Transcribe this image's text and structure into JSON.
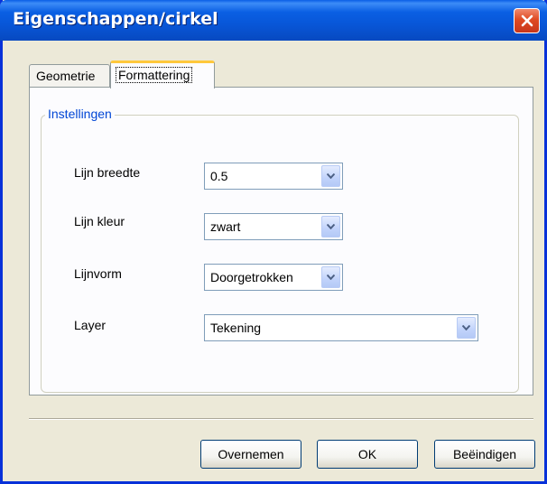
{
  "window": {
    "title": "Eigenschappen/cirkel"
  },
  "tabs": [
    {
      "label": "Geometrie",
      "selected": false
    },
    {
      "label": "Formattering",
      "selected": true
    }
  ],
  "group": {
    "legend": "Instellingen"
  },
  "fields": [
    {
      "label": "Lijn breedte",
      "value": "0.5"
    },
    {
      "label": "Lijn kleur",
      "value": "zwart"
    },
    {
      "label": "Lijnvorm",
      "value": "Doorgetrokken"
    },
    {
      "label": "Layer",
      "value": "Tekening"
    }
  ],
  "buttons": {
    "overnemen": "Overnemen",
    "ok": "OK",
    "beeindigen": "Beëindigen"
  },
  "icons": {
    "close": "close-icon",
    "dropdown": "chevron-down-icon"
  },
  "colors": {
    "titlebar": "#0a5fe3",
    "close_button": "#df4a22",
    "group_legend": "#0046d5",
    "active_tab_highlight": "#ffc83c"
  }
}
